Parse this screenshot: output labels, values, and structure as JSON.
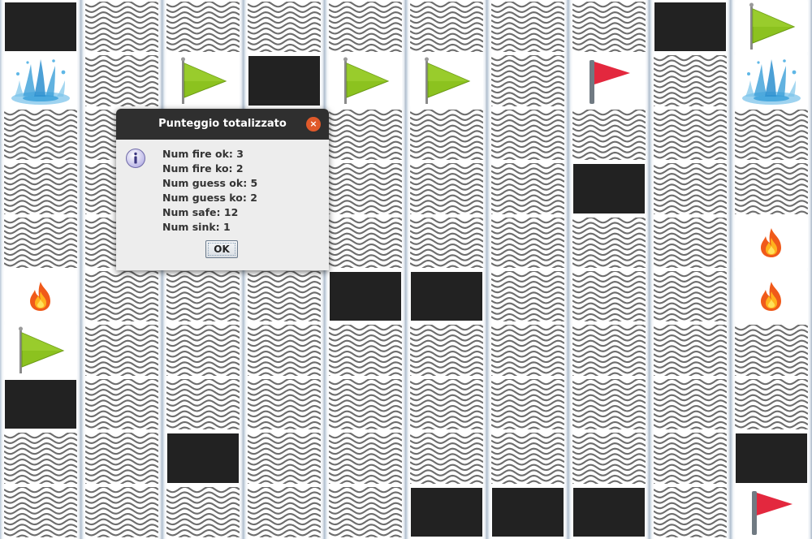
{
  "board": {
    "columns": 10,
    "rows": 10,
    "cells": [
      [
        "black",
        "water",
        "water",
        "water",
        "water",
        "water",
        "water",
        "water",
        "black",
        "flag-green"
      ],
      [
        "splash",
        "water",
        "flag-green",
        "black",
        "flag-green",
        "flag-green",
        "water",
        "flag-red",
        "water",
        "splash"
      ],
      [
        "water",
        "water",
        "water",
        "water",
        "water",
        "water",
        "water",
        "water",
        "water",
        "water"
      ],
      [
        "water",
        "water",
        "water",
        "water",
        "water",
        "water",
        "water",
        "black",
        "water",
        "water"
      ],
      [
        "water",
        "water",
        "water",
        "water",
        "water",
        "water",
        "water",
        "water",
        "water",
        "fire"
      ],
      [
        "fire",
        "water",
        "water",
        "water",
        "black",
        "black",
        "water",
        "water",
        "water",
        "fire"
      ],
      [
        "flag-green",
        "water",
        "water",
        "water",
        "water",
        "water",
        "water",
        "water",
        "water",
        "water"
      ],
      [
        "black",
        "water",
        "water",
        "water",
        "water",
        "water",
        "water",
        "water",
        "water",
        "water"
      ],
      [
        "water",
        "water",
        "black",
        "water",
        "water",
        "water",
        "water",
        "water",
        "water",
        "black"
      ],
      [
        "water",
        "water",
        "water",
        "water",
        "water",
        "black",
        "black",
        "black",
        "water",
        "flag-red"
      ]
    ],
    "colors": {
      "hidden": "#222222",
      "flag_green": "#8cc21f",
      "flag_red": "#e3283e",
      "fire": "#f05a1a",
      "splash": "#3a9fd8"
    }
  },
  "dialog": {
    "title": "Punteggio totalizzato",
    "close_icon": "close-icon",
    "info_icon": "info-icon",
    "lines": [
      "Num fire ok: 3",
      "Num fire ko: 2",
      "Num guess ok: 5",
      "Num guess ko: 2",
      "Num safe: 12",
      "Num sink: 1"
    ],
    "ok_label": "OK"
  }
}
